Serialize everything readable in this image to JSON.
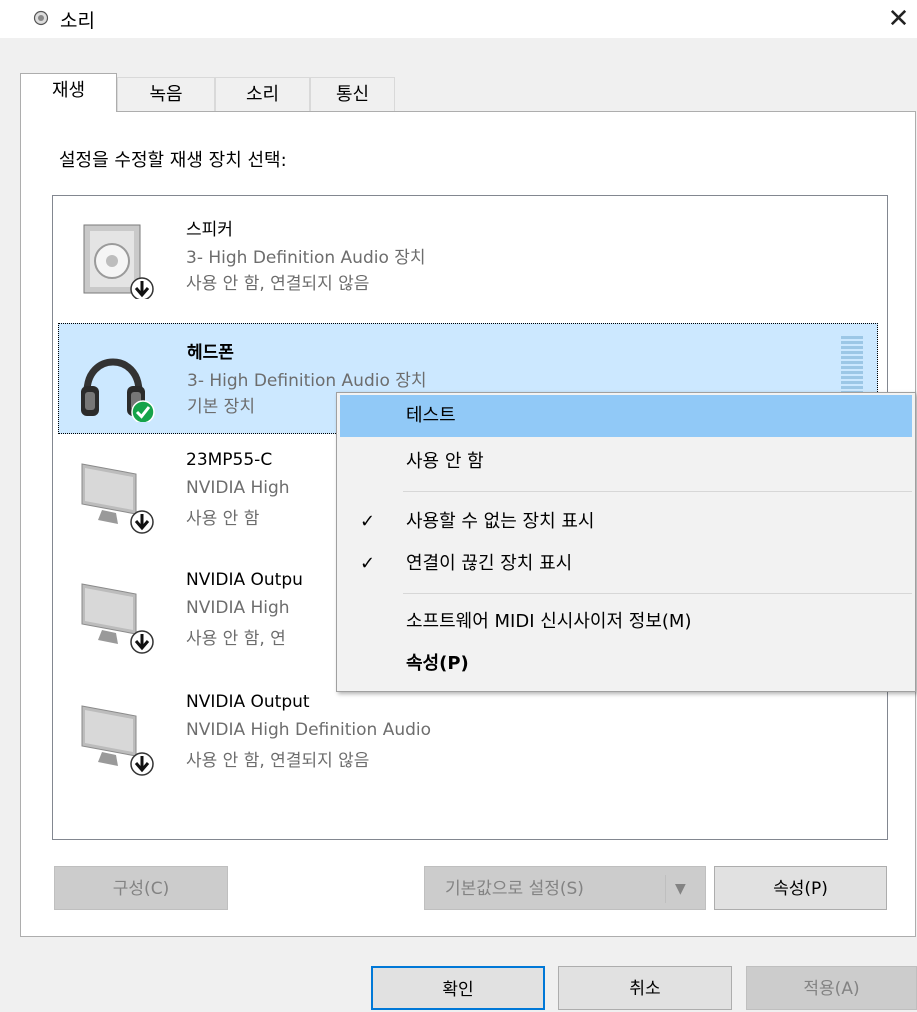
{
  "window": {
    "title": "소리"
  },
  "tabs": [
    {
      "label": "재생"
    },
    {
      "label": "녹음"
    },
    {
      "label": "소리"
    },
    {
      "label": "통신"
    }
  ],
  "prompt": "설정을 수정할 재생 장치 선택:",
  "devices": [
    {
      "name": "스피커",
      "line1": "3- High Definition Audio 장치",
      "line2": "사용 안 함, 연결되지 않음",
      "icon": "speaker-icon",
      "badge": "disabled-arrow"
    },
    {
      "name": "헤드폰",
      "line1": "3- High Definition Audio 장치",
      "line2": "기본 장치",
      "icon": "headphones-icon",
      "badge": "default-check",
      "selected": true
    },
    {
      "name": "23MP55-C",
      "line1": "NVIDIA High",
      "line2": "사용 안 함",
      "icon": "monitor-icon",
      "badge": "disabled-arrow"
    },
    {
      "name": "NVIDIA Outpu",
      "line1": "NVIDIA High",
      "line2": "사용 안 함, 연",
      "icon": "monitor-icon",
      "badge": "disabled-arrow"
    },
    {
      "name": "NVIDIA Output",
      "line1": "NVIDIA High Definition Audio",
      "line2": "사용 안 함, 연결되지 않음",
      "icon": "monitor-icon",
      "badge": "disabled-arrow"
    }
  ],
  "buttons": {
    "configure": "구성(C)",
    "set_default": "기본값으로 설정(S)",
    "properties": "속성(P)",
    "ok": "확인",
    "cancel": "취소",
    "apply": "적용(A)"
  },
  "context_menu": {
    "items": [
      {
        "label": "테스트"
      },
      {
        "label": "사용 안 함"
      },
      {
        "label": "사용할 수 없는 장치 표시",
        "checked": true
      },
      {
        "label": "연결이 끊긴 장치 표시",
        "checked": true
      },
      {
        "label": "소프트웨어 MIDI 신시사이저 정보(M)"
      },
      {
        "label": "속성(P)"
      }
    ],
    "check_glyph": "✓"
  },
  "colors": {
    "selection": "#cce8ff",
    "menu_highlight": "#91c9f7",
    "accent": "#0078d7",
    "check_badge": "#16a34a"
  }
}
